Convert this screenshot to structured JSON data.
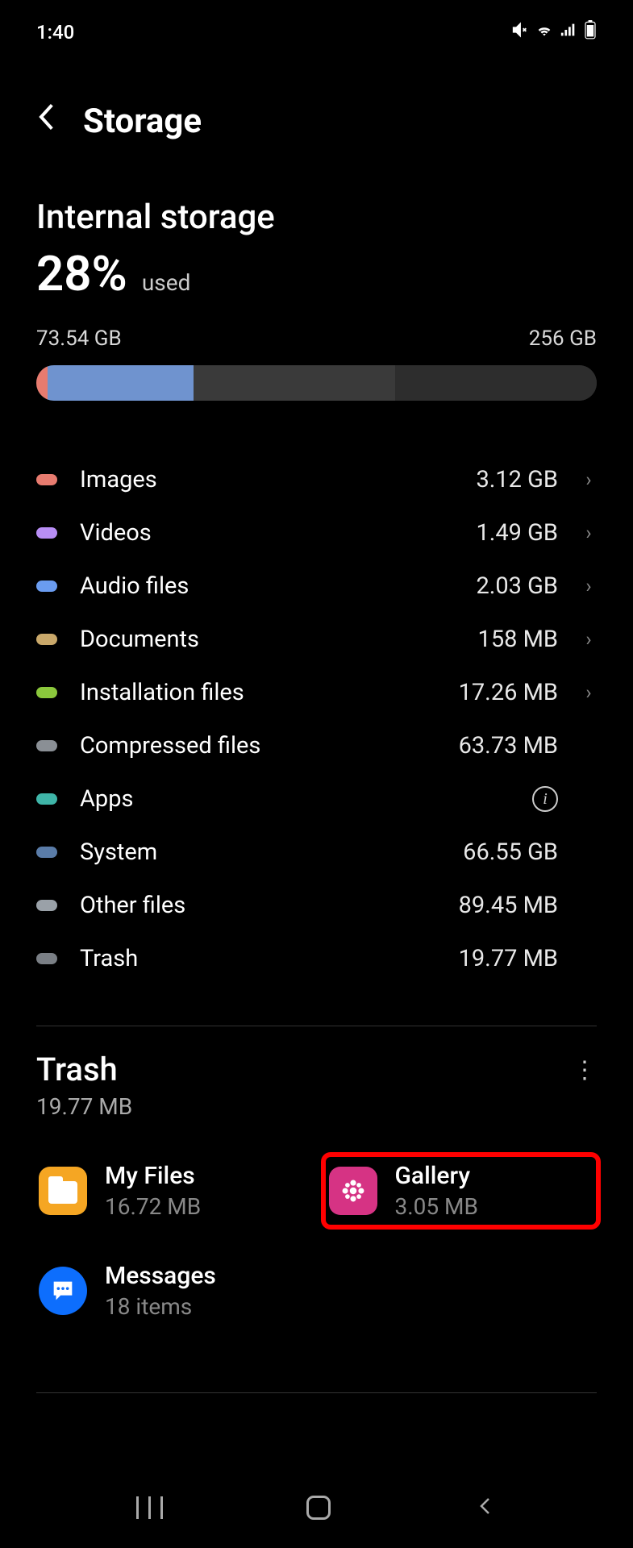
{
  "status": {
    "time": "1:40"
  },
  "header": {
    "title": "Storage"
  },
  "internal": {
    "title": "Internal storage",
    "percent": "28%",
    "used_label": "used",
    "used_size": "73.54 GB",
    "total_size": "256 GB"
  },
  "categories": [
    {
      "label": "Images",
      "size": "3.12 GB",
      "color": "#e77b6f",
      "chevron": true
    },
    {
      "label": "Videos",
      "size": "1.49 GB",
      "color": "#b88ef5",
      "chevron": true
    },
    {
      "label": "Audio files",
      "size": "2.03 GB",
      "color": "#6a9cf0",
      "chevron": true
    },
    {
      "label": "Documents",
      "size": "158 MB",
      "color": "#c9a86a",
      "chevron": true
    },
    {
      "label": "Installation files",
      "size": "17.26 MB",
      "color": "#8bc83c",
      "chevron": true
    },
    {
      "label": "Compressed files",
      "size": "63.73 MB",
      "color": "#8a8f95",
      "chevron": false
    },
    {
      "label": "Apps",
      "size": "",
      "color": "#3fb5a8",
      "chevron": false,
      "info": true
    },
    {
      "label": "System",
      "size": "66.55 GB",
      "color": "#5a7ca8",
      "chevron": false
    },
    {
      "label": "Other files",
      "size": "89.45 MB",
      "color": "#9aa1a8",
      "chevron": false
    },
    {
      "label": "Trash",
      "size": "19.77 MB",
      "color": "#7a7f85",
      "chevron": false
    }
  ],
  "trash": {
    "title": "Trash",
    "size": "19.77 MB",
    "apps": [
      {
        "name": "My Files",
        "sub": "16.72 MB",
        "icon": "my-files"
      },
      {
        "name": "Gallery",
        "sub": "3.05 MB",
        "icon": "gallery",
        "highlight": true
      },
      {
        "name": "Messages",
        "sub": "18 items",
        "icon": "messages"
      }
    ]
  },
  "progress_segments": [
    {
      "color": "#e77b6f",
      "width": "2%"
    },
    {
      "color": "#6f93cf",
      "width": "26%"
    },
    {
      "color": "#3a3a3a",
      "width": "36%"
    },
    {
      "color": "#2d2d2d",
      "width": "36%"
    }
  ]
}
